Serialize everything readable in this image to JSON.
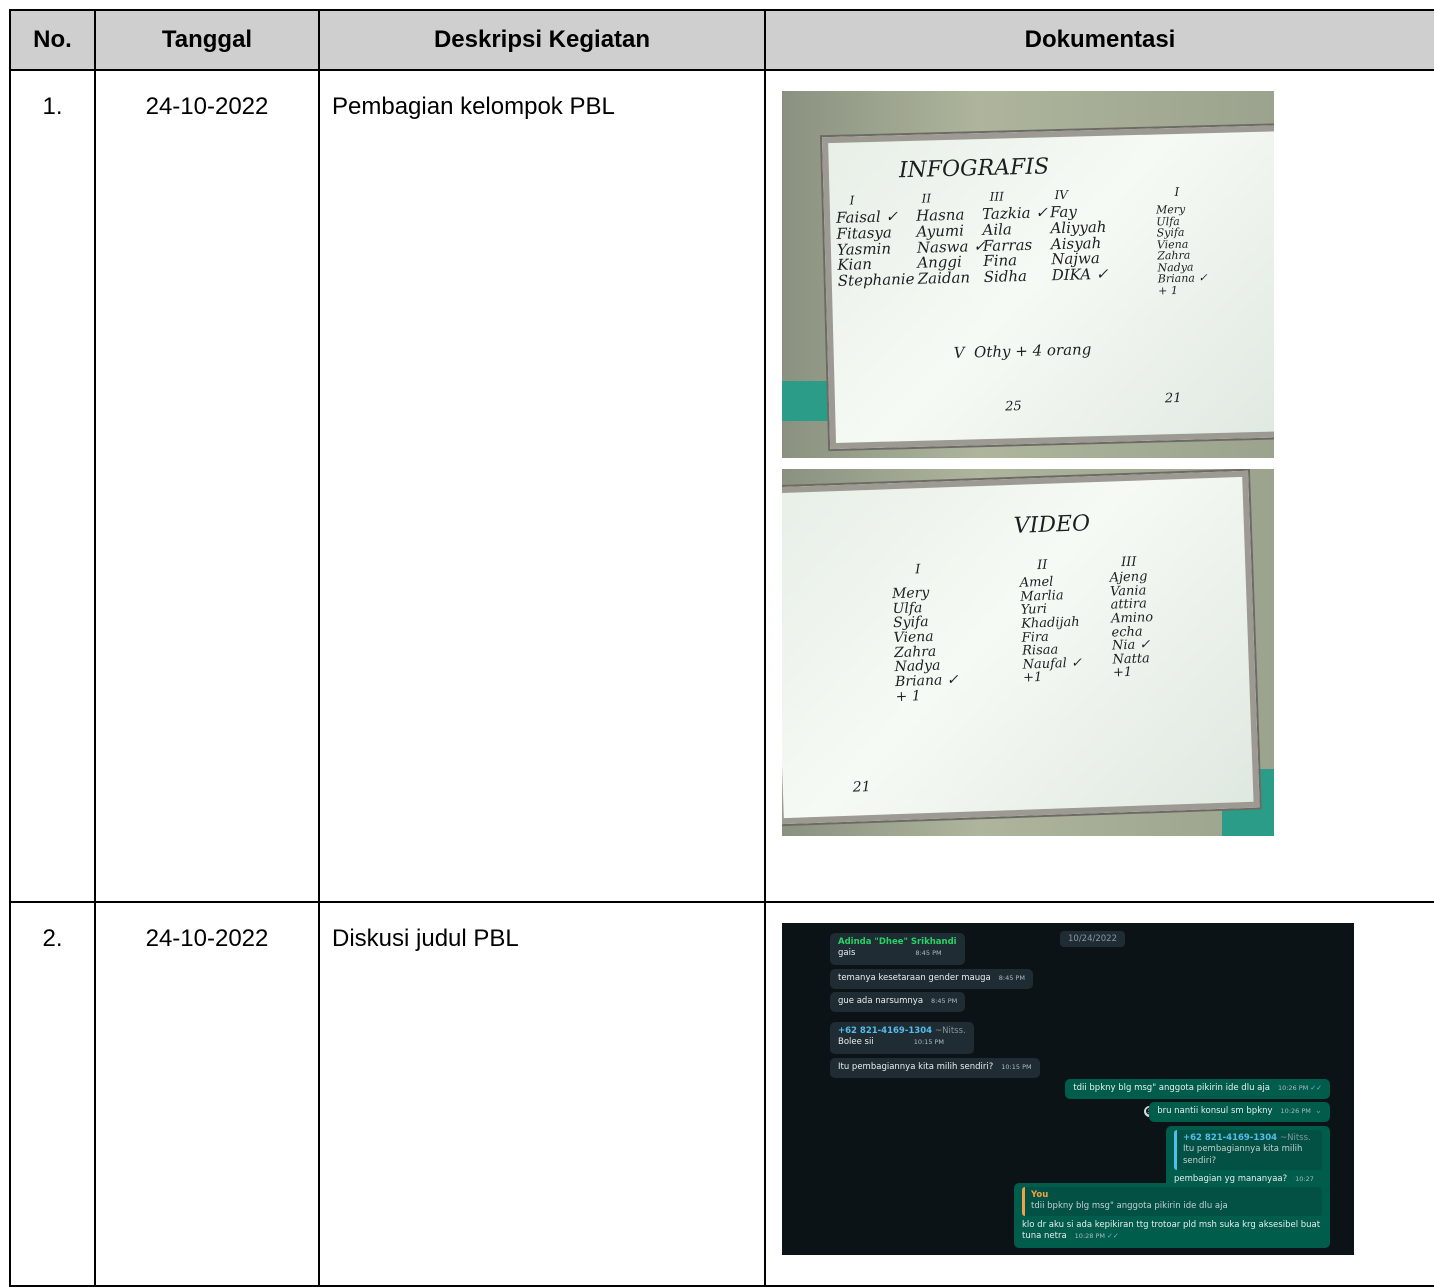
{
  "table": {
    "headers": {
      "no": "No.",
      "date": "Tanggal",
      "desc": "Deskripsi Kegiatan",
      "doc": "Dokumentasi"
    },
    "rows": [
      {
        "no": "1.",
        "date": "24-10-2022",
        "desc": "Pembagian kelompok PBL"
      },
      {
        "no": "2.",
        "date": "24-10-2022",
        "desc": "Diskusi judul PBL"
      }
    ]
  },
  "photo1": {
    "title": "INFOGRAFIS",
    "numerals": [
      "I",
      "II",
      "III",
      "IV",
      "I"
    ],
    "col1": "Faisal ✓\nFitasya\nYasmin\nKian\nStephanie",
    "col2": "Hasna\nAyumi\nNaswa ✓\nAnggi\nZaidan",
    "col3": "Tazkia ✓\nAila\nFarras\nFina\nSidha",
    "col4": "Fay\nAliyyah\nAisyah\nNajwa\nDIKA ✓",
    "col5": "Mery\nUlfa\nSyifa\nViena\nZahra\nNadya\nBriana ✓\n+ 1",
    "extra": "V  Othy + 4 orang",
    "count1": "25",
    "count2": "21"
  },
  "photo2": {
    "title": "VIDEO",
    "numerals": [
      "I",
      "II",
      "III"
    ],
    "col1": "Mery\nUlfa\nSyifa\nViena\nZahra\nNadya\nBriana ✓\n+ 1",
    "col2": "Amel\nMarlia\nYuri\nKhadijah\nFira\nRisaa\nNaufal ✓\n+1",
    "col3": "Ajeng\nVania\nattira\nAmino\necha\nNia ✓\nNatta\n+1",
    "count": "21"
  },
  "chat": {
    "date": "10/24/2022",
    "m1": {
      "sender": "Adinda \"Dhee\" Srikhandi",
      "text": "gais",
      "time": "8:45 PM"
    },
    "m2": {
      "text": "temanya kesetaraan gender mauga",
      "time": "8:45 PM"
    },
    "m3": {
      "text": "gue ada narsumnya",
      "time": "8:45 PM"
    },
    "m4": {
      "sender": "+62 821-4169-1304",
      "alias": "~Nitss.",
      "text": "Bolee sii",
      "time": "10:15 PM"
    },
    "m5": {
      "text": "Itu pembagiannya kita milih sendiri?",
      "time": "10:15 PM"
    },
    "m6": {
      "text": "tdii bpkny blg msg\" anggota pikirin ide dlu aja",
      "time": "10:26 PM"
    },
    "m7": {
      "text": "bru nantii konsul sm bpkny",
      "time": "10:26 PM"
    },
    "m8": {
      "quote_sender": "+62 821-4169-1304",
      "quote_alias": "~Nitss.",
      "quote_text": "Itu pembagiannya kita milih sendiri?",
      "text": "pembagian yg mananyaa?",
      "time": "10:27 PM"
    },
    "m9": {
      "quote_sender": "You",
      "quote_text": "tdii bpkny blg msg\" anggota pikirin ide dlu aja",
      "text": "klo dr aku si ada kepikiran ttg trotoar pld msh suka krg aksesibel buat tuna netra",
      "time": "10:28 PM"
    }
  }
}
